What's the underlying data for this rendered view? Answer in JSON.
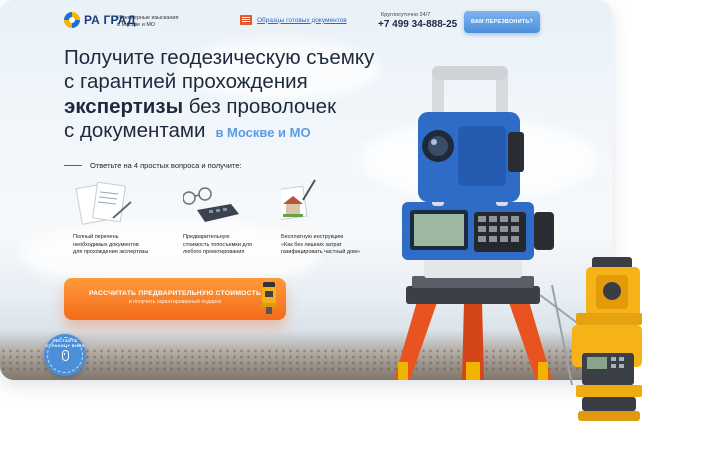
{
  "header": {
    "logo_text": "РА ГРАД",
    "tagline_line1": "Инженерные изыскания",
    "tagline_line2": "в Москве и МО",
    "samples_link": "Образцы готовых документов",
    "hours": "Круглосуточно 24/7",
    "phone": "+7 499 34-888-25",
    "callback_button": "ВАМ ПЕРЕЗВОНИТЬ?"
  },
  "hero": {
    "line1": "Получите геодезическую съемку",
    "line2": "с гарантией прохождения",
    "line3_bold": "экспертизы",
    "line3_rest": " без проволочек",
    "line4": "с документами",
    "location": "в Москве и МО"
  },
  "quiz": {
    "lead": "Ответьте на 4 простых вопроса и получите:"
  },
  "features": [
    {
      "line1": "Полный перечень",
      "line2": "необходимых документов",
      "line3": "для прохождения экспертизы"
    },
    {
      "line1": "Предварительную",
      "line2": "стоимость топосъемки для",
      "line3": "любого проектирования"
    },
    {
      "line1": "Бесплатную инструкцию",
      "line2": "«Как без лишних затрат",
      "line3": "газифицировать частный дом»"
    }
  ],
  "cta": {
    "main": "РАССЧИТАТЬ ПРЕДВАРИТЕЛЬНУЮ СТОИМОСТЬ",
    "sub": "и получить гарантированный подарок"
  },
  "scroll_badge": {
    "text": "ЛИСТАЙТЕ СТРАНИЦУ ВНИЗ"
  },
  "colors": {
    "accent_blue": "#2a6bc4",
    "cta_orange": "#f36b1a",
    "location_blue": "#5b9be6",
    "heading": "#1e2a3c"
  },
  "icons": [
    "logo-mark-icon",
    "document-icon",
    "documents-stack-icon",
    "calculator-glasses-icon",
    "house-photo-icon",
    "total-station-icon",
    "mouse-scroll-icon"
  ]
}
